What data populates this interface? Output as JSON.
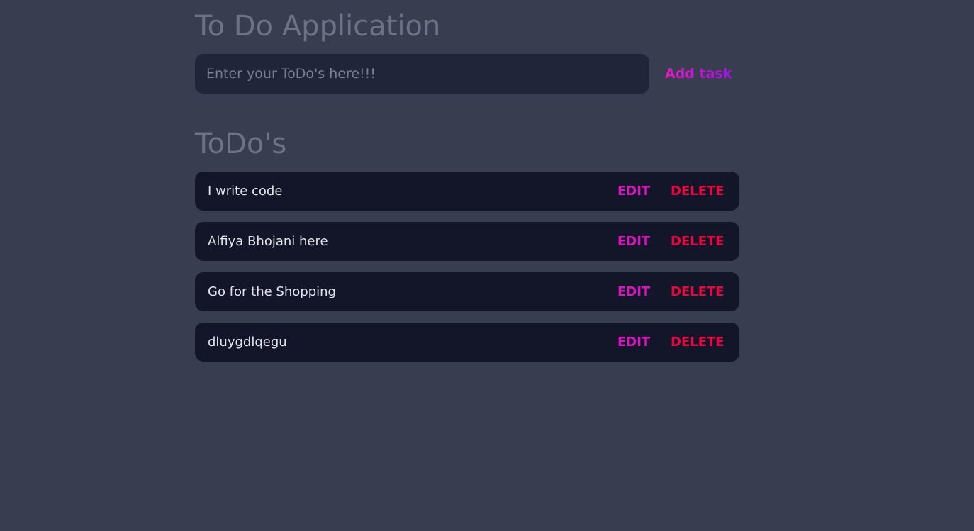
{
  "app": {
    "title": "To Do Application"
  },
  "input": {
    "placeholder": "Enter your ToDo's here!!!",
    "value": "",
    "add_label": "Add task"
  },
  "list": {
    "title": "ToDo's",
    "edit_label": "EDIT",
    "delete_label": "DELETE",
    "items": [
      {
        "text": "I write code"
      },
      {
        "text": "Alfiya Bhojani here"
      },
      {
        "text": "Go for the Shopping"
      },
      {
        "text": "dluygdlqegu"
      }
    ]
  },
  "colors": {
    "background": "#393d50",
    "input_background": "#21253a",
    "item_background": "#131629",
    "edit": "#dd14c2",
    "delete": "#e8073e",
    "accent_start": "#e21bbf",
    "accent_end": "#a312e6"
  }
}
